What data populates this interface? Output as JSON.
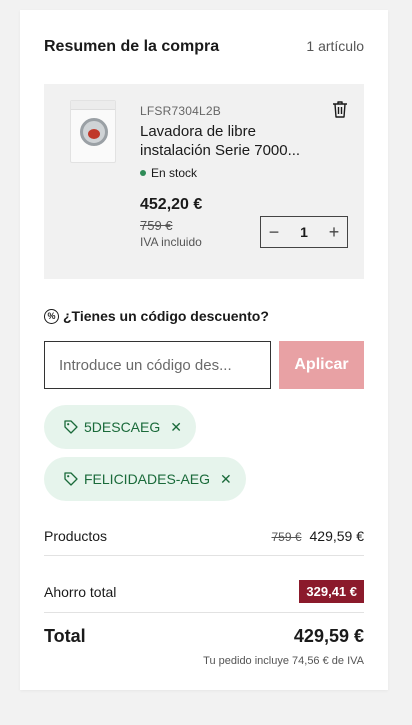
{
  "header": {
    "title": "Resumen de la compra",
    "count": "1 artículo"
  },
  "product": {
    "sku": "LFSR7304L2B",
    "name": "Lavadora de libre instalación Serie 7000...",
    "stock": "En stock",
    "price": "452,20 €",
    "old_price": "759 €",
    "vat": "IVA incluido",
    "quantity": "1",
    "decrement": "−",
    "increment": "+"
  },
  "promo": {
    "title": "¿Tienes un código descuento?",
    "icon": "%",
    "placeholder": "Introduce un código des...",
    "apply_label": "Aplicar",
    "codes": [
      {
        "label": "5DESCAEG"
      },
      {
        "label": "FELICIDADES-AEG"
      }
    ],
    "remove_symbol": "✕"
  },
  "summary": {
    "products_label": "Productos",
    "products_old": "759 €",
    "products_price": "429,59 €",
    "savings_label": "Ahorro total",
    "savings_value": "329,41 €",
    "total_label": "Total",
    "total_value": "429,59 €",
    "vat_note": "Tu pedido incluye 74,56 € de IVA"
  },
  "colors": {
    "accent_apply": "#e8a1a4",
    "savings_badge": "#8b1a2b",
    "coupon_bg": "#e6f4ec",
    "coupon_text": "#1a6a3a",
    "stock_dot": "#2e8b57"
  }
}
